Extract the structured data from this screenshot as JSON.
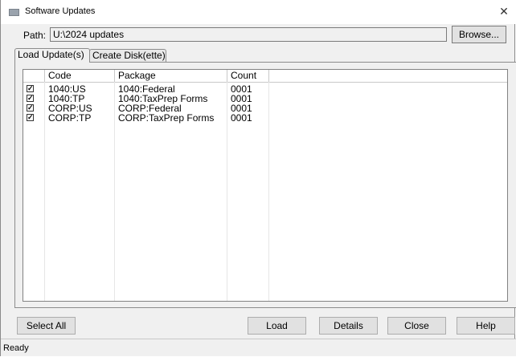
{
  "window": {
    "title": "Software Updates",
    "close_glyph": "✕"
  },
  "path": {
    "label": "Path:",
    "value": "U:\\2024 updates",
    "browse_label": "Browse..."
  },
  "tabs": [
    {
      "label": "Load Update(s)",
      "active": true
    },
    {
      "label": "Create Disk(ette)",
      "active": false
    }
  ],
  "table": {
    "columns": [
      "Code",
      "Package",
      "Count"
    ],
    "rows": [
      {
        "checked": true,
        "code": "1040:US",
        "package": "1040:Federal",
        "count": "0001"
      },
      {
        "checked": true,
        "code": "1040:TP",
        "package": "1040:TaxPrep Forms",
        "count": "0001"
      },
      {
        "checked": true,
        "code": "CORP:US",
        "package": "CORP:Federal",
        "count": "0001"
      },
      {
        "checked": true,
        "code": "CORP:TP",
        "package": "CORP:TaxPrep Forms",
        "count": "0001"
      }
    ]
  },
  "buttons": {
    "select_all": "Select All",
    "load": "Load",
    "details": "Details",
    "close": "Close",
    "help": "Help"
  },
  "status": {
    "text": "Ready"
  }
}
